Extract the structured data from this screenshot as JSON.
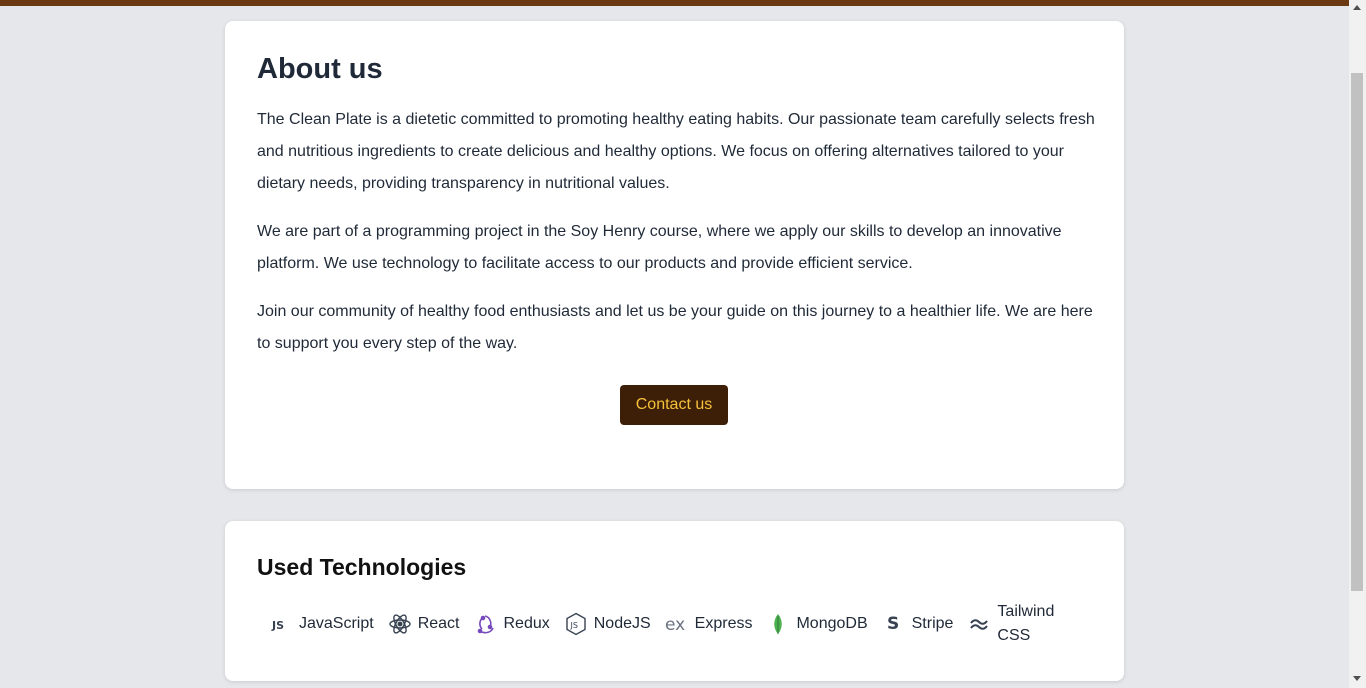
{
  "about": {
    "title": "About us",
    "paragraphs": [
      "The Clean Plate is a dietetic committed to promoting healthy eating habits. Our passionate team carefully selects fresh and nutritious ingredients to create delicious and healthy options. We focus on offering alternatives tailored to your dietary needs, providing transparency in nutritional values.",
      "We are part of a programming project in the Soy Henry course, where we apply our skills to develop an innovative platform. We use technology to facilitate access to our products and provide efficient service.",
      "Join our community of healthy food enthusiasts and let us be your guide on this journey to a healthier life. We are here to support you every step of the way."
    ],
    "contact_button": "Contact us"
  },
  "technologies": {
    "title": "Used Technologies",
    "items": [
      {
        "label": "JavaScript",
        "icon": "javascript-icon"
      },
      {
        "label": "React",
        "icon": "react-icon"
      },
      {
        "label": "Redux",
        "icon": "redux-icon"
      },
      {
        "label": "NodeJS",
        "icon": "nodejs-icon"
      },
      {
        "label": "Express",
        "icon": "express-icon"
      },
      {
        "label": "MongoDB",
        "icon": "mongodb-icon"
      },
      {
        "label": "Stripe",
        "icon": "stripe-icon"
      },
      {
        "label": "Tailwind CSS",
        "icon": "tailwind-icon"
      }
    ]
  },
  "colors": {
    "top_bar": "#6b3a13",
    "button_bg": "#3d1e07",
    "button_text": "#f5c13a",
    "page_bg": "#e5e7eb"
  }
}
